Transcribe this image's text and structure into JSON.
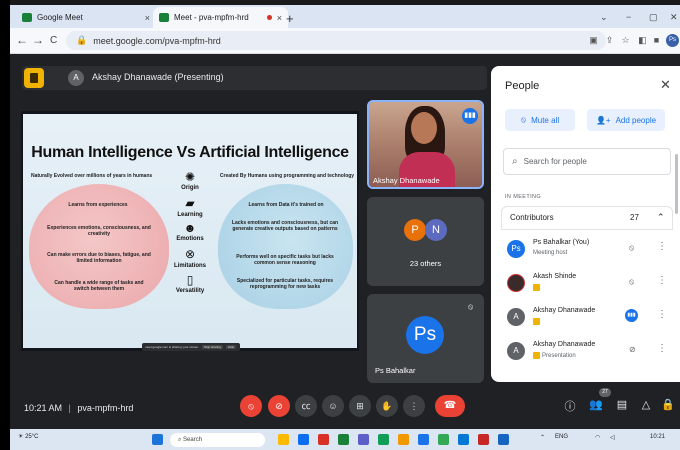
{
  "browser": {
    "tabs": [
      {
        "title": "Google Meet",
        "close": "×",
        "favicon_color": "#188038"
      },
      {
        "title": "Meet - pva-mpfm-hrd",
        "close": "×",
        "favicon_color": "#188038"
      }
    ],
    "new_tab": "+",
    "window_controls": [
      "⌄",
      "−",
      "▢",
      "✕"
    ],
    "nav": {
      "back": "←",
      "forward": "→",
      "reload": "C"
    },
    "url": "meet.google.com/pva-mpfm-hrd",
    "profile_initials": "Ps"
  },
  "meeting": {
    "presenter_bar": {
      "avatar_initial": "A",
      "text": "Akshay Dhanawade (Presenting)"
    },
    "slide": {
      "title": "Human Intelligence Vs Artificial Intelligence",
      "left_subtitle": "Naturally Evolved over millions of years in humans",
      "right_subtitle": "Created By Humans using programming and technology",
      "left_points": [
        "Learns from experiences",
        "Experiences emotions, consciousness, and creativity",
        "Can make errors due to biases, fatigue, and limited information",
        "Can handle a wide range of tasks and switch between them"
      ],
      "right_points": [
        "Learns from Data it's trained on",
        "Lacks emotions and consciousness, but can generate creative outputs based on patterns",
        "Performs well on specific tasks but lacks common sense reasoning",
        "Specialized for particular tasks, requires reprogramming for new tasks"
      ],
      "middle_labels": [
        "Origin",
        "Learning",
        "Emotions",
        "Limitations",
        "Versatility"
      ],
      "share_bar": {
        "text": "meet.google.com is sharing your screen.",
        "stop": "Stop sharing",
        "hide": "Hide"
      }
    },
    "tiles": {
      "speaker_name": "Akshay Dhanawade",
      "others": {
        "initials": [
          "P",
          "N"
        ],
        "label": "23 others"
      },
      "self": {
        "initials": "Ps",
        "name": "Ps Bahalkar"
      }
    },
    "bottom": {
      "time": "10:21 AM",
      "separator": "|",
      "code": "pva-mpfm-hrd",
      "people_count": "27"
    }
  },
  "people_panel": {
    "title": "People",
    "mute_all": "Mute all",
    "add_people": "Add people",
    "search_placeholder": "Search for people",
    "section": "IN MEETING",
    "group": {
      "label": "Contributors",
      "count": "27"
    },
    "participants": [
      {
        "initials": "Ps",
        "name": "Ps Bahalkar (You)",
        "sub": "Meeting host",
        "color": "#1a73e8"
      },
      {
        "initials": "",
        "name": "Akash Shinde",
        "sub": "",
        "color": "#3a2a2a"
      },
      {
        "initials": "A",
        "name": "Akshay Dhanawade",
        "sub": "",
        "color": "#5f6368"
      },
      {
        "initials": "A",
        "name": "Akshay Dhanawade",
        "sub": "Presentation",
        "color": "#5f6368"
      }
    ]
  },
  "taskbar": {
    "weather": "25°C",
    "search": "Search",
    "lang": "ENG",
    "time": "10:21"
  },
  "colors": {
    "meet_bg": "#202124",
    "accent": "#1a73e8",
    "danger": "#ea4335",
    "panel_bg": "#ffffff"
  }
}
